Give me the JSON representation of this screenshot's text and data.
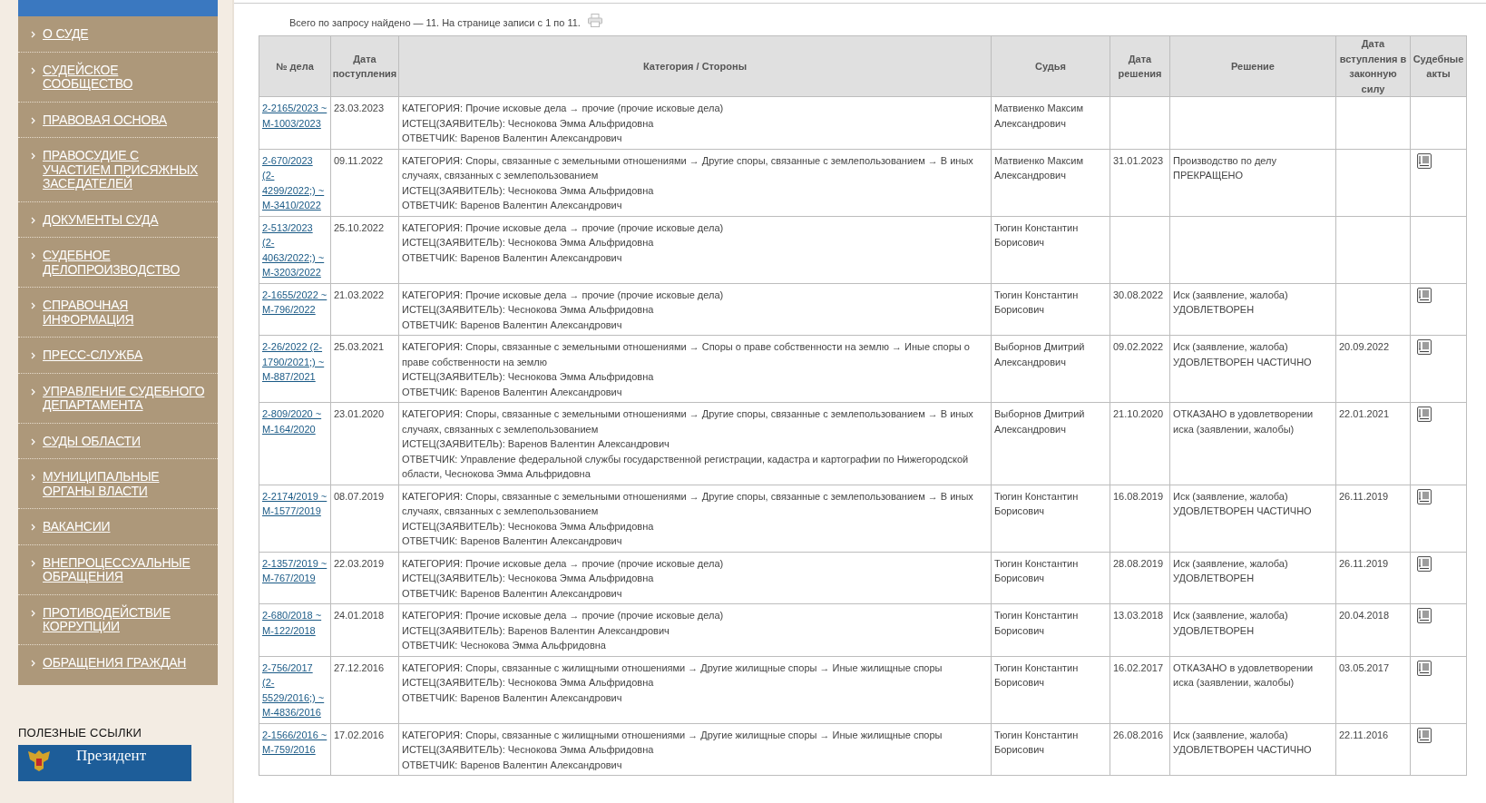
{
  "sidebar": {
    "menu": [
      {
        "label": "О СУДЕ"
      },
      {
        "label": "СУДЕЙСКОЕ СООБЩЕСТВО"
      },
      {
        "label": "ПРАВОВАЯ ОСНОВА"
      },
      {
        "label": "ПРАВОСУДИЕ С УЧАСТИЕМ ПРИСЯЖНЫХ ЗАСЕДАТЕЛЕЙ"
      },
      {
        "label": "ДОКУМЕНТЫ СУДА"
      },
      {
        "label": "СУДЕБНОЕ ДЕЛОПРОИЗВОДСТВО"
      },
      {
        "label": "СПРАВОЧНАЯ ИНФОРМАЦИЯ"
      },
      {
        "label": "ПРЕСС-СЛУЖБА"
      },
      {
        "label": "УПРАВЛЕНИЕ СУДЕБНОГО ДЕПАРТАМЕНТА"
      },
      {
        "label": "СУДЫ ОБЛАСТИ"
      },
      {
        "label": "МУНИЦИПАЛЬНЫЕ ОРГАНЫ ВЛАСТИ"
      },
      {
        "label": "ВАКАНСИИ"
      },
      {
        "label": "ВНЕПРОЦЕССУАЛЬНЫЕ ОБРАЩЕНИЯ"
      },
      {
        "label": "ПРОТИВОДЕЙСТВИЕ КОРРУПЦИИ"
      },
      {
        "label": "ОБРАЩЕНИЯ ГРАЖДАН"
      }
    ],
    "useful_links_title": "ПОЛЕЗНЫЕ ССЫЛКИ",
    "banner": {
      "label": "Президент"
    }
  },
  "results_summary": "Всего по запросу найдено — 11. На странице записи с 1 по 11.",
  "table": {
    "columns": [
      "№ дела",
      "Дата поступления",
      "Категория / Стороны",
      "Судья",
      "Дата решения",
      "Решение",
      "Дата вступления в законную силу",
      "Судебные акты"
    ],
    "rows": [
      {
        "case_number": "2-2165/2023 ~ М-1003/2023",
        "received": "23.03.2023",
        "category": "КАТЕГОРИЯ: Прочие исковые дела → прочие (прочие исковые дела)",
        "plaintiff": "ИСТЕЦ(ЗАЯВИТЕЛЬ): Чеснокова Эмма Альфридовна",
        "defendant": "ОТВЕТЧИК: Варенов Валентин Александрович",
        "judge": "Матвиенко Максим Александрович",
        "has_act": false
      },
      {
        "case_number": "2-670/2023 (2-4299/2022;) ~ М-3410/2022",
        "received": "09.11.2022",
        "category": "КАТЕГОРИЯ: Споры, связанные с земельными отношениями → Другие споры, связанные с землепользованием → В иных случаях, связанных с землепользованием",
        "plaintiff": "ИСТЕЦ(ЗАЯВИТЕЛЬ): Чеснокова Эмма Альфридовна",
        "defendant": "ОТВЕТЧИК: Варенов Валентин Александрович",
        "judge": "Матвиенко Максим Александрович",
        "decision_date": "31.01.2023",
        "decision": "Производство по делу ПРЕКРАЩЕНО",
        "has_act": true
      },
      {
        "case_number": "2-513/2023 (2-4063/2022;) ~ М-3203/2022",
        "received": "25.10.2022",
        "category": "КАТЕГОРИЯ: Прочие исковые дела → прочие (прочие исковые дела)",
        "plaintiff": "ИСТЕЦ(ЗАЯВИТЕЛЬ): Чеснокова Эмма Альфридовна",
        "defendant": "ОТВЕТЧИК: Варенов Валентин Александрович",
        "judge": "Тюгин Константин Борисович",
        "has_act": false
      },
      {
        "case_number": "2-1655/2022 ~ М-796/2022",
        "received": "21.03.2022",
        "category": "КАТЕГОРИЯ: Прочие исковые дела → прочие (прочие исковые дела)",
        "plaintiff": "ИСТЕЦ(ЗАЯВИТЕЛЬ): Чеснокова Эмма Альфридовна",
        "defendant": "ОТВЕТЧИК: Варенов Валентин Александрович",
        "judge": "Тюгин Константин Борисович",
        "decision_date": "30.08.2022",
        "decision": "Иск (заявление, жалоба) УДОВЛЕТВОРЕН",
        "has_act": true
      },
      {
        "case_number": "2-26/2022 (2-1790/2021;) ~ М-887/2021",
        "received": "25.03.2021",
        "category": "КАТЕГОРИЯ: Споры, связанные с земельными отношениями → Споры о праве собственности на землю → Иные споры о праве собственности на землю",
        "plaintiff": "ИСТЕЦ(ЗАЯВИТЕЛЬ): Чеснокова Эмма Альфридовна",
        "defendant": "ОТВЕТЧИК: Варенов Валентин Александрович",
        "judge": "Выборнов Дмитрий Александрович",
        "decision_date": "09.02.2022",
        "decision": "Иск (заявление, жалоба) УДОВЛЕТВОРЕН ЧАСТИЧНО",
        "effective_date": "20.09.2022",
        "has_act": true
      },
      {
        "case_number": "2-809/2020 ~ М-164/2020",
        "received": "23.01.2020",
        "category": "КАТЕГОРИЯ: Споры, связанные с земельными отношениями → Другие споры, связанные с землепользованием → В иных случаях, связанных с землепользованием",
        "plaintiff": "ИСТЕЦ(ЗАЯВИТЕЛЬ): Варенов Валентин Александрович",
        "defendant": "ОТВЕТЧИК: Управление федеральной службы государственной регистрации, кадастра и картографии по Нижегородской области, Чеснокова Эмма Альфридовна",
        "judge": "Выборнов Дмитрий Александрович",
        "decision_date": "21.10.2020",
        "decision": "ОТКАЗАНО в удовлетворении иска (заявлении, жалобы)",
        "effective_date": "22.01.2021",
        "has_act": true
      },
      {
        "case_number": "2-2174/2019 ~ М-1577/2019",
        "received": "08.07.2019",
        "category": "КАТЕГОРИЯ: Споры, связанные с земельными отношениями → Другие споры, связанные с землепользованием → В иных случаях, связанных с землепользованием",
        "plaintiff": "ИСТЕЦ(ЗАЯВИТЕЛЬ): Чеснокова Эмма Альфридовна",
        "defendant": "ОТВЕТЧИК: Варенов Валентин Александрович",
        "judge": "Тюгин Константин Борисович",
        "decision_date": "16.08.2019",
        "decision": "Иск (заявление, жалоба) УДОВЛЕТВОРЕН ЧАСТИЧНО",
        "effective_date": "26.11.2019",
        "has_act": true
      },
      {
        "case_number": "2-1357/2019 ~ М-767/2019",
        "received": "22.03.2019",
        "category": "КАТЕГОРИЯ: Прочие исковые дела → прочие (прочие исковые дела)",
        "plaintiff": "ИСТЕЦ(ЗАЯВИТЕЛЬ): Чеснокова Эмма Альфридовна",
        "defendant": "ОТВЕТЧИК: Варенов Валентин Александрович",
        "judge": "Тюгин Константин Борисович",
        "decision_date": "28.08.2019",
        "decision": "Иск (заявление, жалоба) УДОВЛЕТВОРЕН",
        "effective_date": "26.11.2019",
        "has_act": true
      },
      {
        "case_number": "2-680/2018 ~ М-122/2018",
        "received": "24.01.2018",
        "category": "КАТЕГОРИЯ: Прочие исковые дела → прочие (прочие исковые дела)",
        "plaintiff": "ИСТЕЦ(ЗАЯВИТЕЛЬ): Варенов Валентин Александрович",
        "defendant": "ОТВЕТЧИК: Чеснокова Эмма Альфридовна",
        "judge": "Тюгин Константин Борисович",
        "decision_date": "13.03.2018",
        "decision": "Иск (заявление, жалоба) УДОВЛЕТВОРЕН",
        "effective_date": "20.04.2018",
        "has_act": true
      },
      {
        "case_number": "2-756/2017 (2-5529/2016;) ~ М-4836/2016",
        "received": "27.12.2016",
        "category": "КАТЕГОРИЯ: Споры, связанные с жилищными отношениями → Другие жилищные споры → Иные жилищные споры",
        "plaintiff": "ИСТЕЦ(ЗАЯВИТЕЛЬ): Чеснокова Эмма Альфридовна",
        "defendant": "ОТВЕТЧИК: Варенов Валентин Александрович",
        "judge": "Тюгин Константин Борисович",
        "decision_date": "16.02.2017",
        "decision": "ОТКАЗАНО в удовлетворении иска (заявлении, жалобы)",
        "effective_date": "03.05.2017",
        "has_act": true
      },
      {
        "case_number": "2-1566/2016 ~ М-759/2016",
        "received": "17.02.2016",
        "category": "КАТЕГОРИЯ: Споры, связанные с жилищными отношениями → Другие жилищные споры → Иные жилищные споры",
        "plaintiff": "ИСТЕЦ(ЗАЯВИТЕЛЬ): Чеснокова Эмма Альфридовна",
        "defendant": "ОТВЕТЧИК: Варенов Валентин Александрович",
        "judge": "Тюгин Константин Борисович",
        "decision_date": "26.08.2016",
        "decision": "Иск (заявление, жалоба) УДОВЛЕТВОРЕН ЧАСТИЧНО",
        "effective_date": "22.11.2016",
        "has_act": true
      }
    ]
  }
}
